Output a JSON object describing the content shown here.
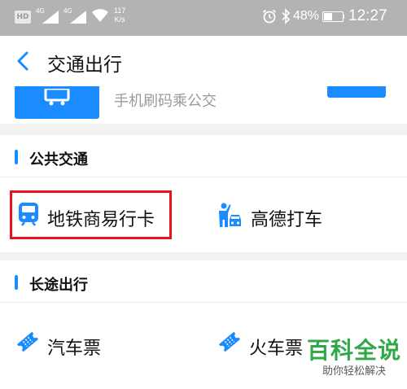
{
  "status_bar": {
    "hd_label": "HD",
    "signal_1_label": "4G",
    "signal_2_label": "4G",
    "net_speed_value": "117",
    "net_speed_unit": "K/s",
    "battery_text": "48%",
    "battery_level": 0.48,
    "time": "12:27"
  },
  "header": {
    "title": "交通出行",
    "accent_color": "#1a8cff"
  },
  "top_card": {
    "subtitle": "手机刷码乘公交"
  },
  "public_transport": {
    "title": "公共交通",
    "items": [
      {
        "label": "地铁商易行卡",
        "icon": "metro-train-icon"
      },
      {
        "label": "高德打车",
        "icon": "taxi-hail-icon"
      }
    ]
  },
  "long_distance": {
    "title": "长途出行",
    "items": [
      {
        "label": "汽车票",
        "icon": "ticket-icon"
      },
      {
        "label": "火车票",
        "icon": "ticket-icon"
      }
    ]
  },
  "watermark": {
    "brand": "百科全说",
    "slogan": "助你轻松解决"
  }
}
